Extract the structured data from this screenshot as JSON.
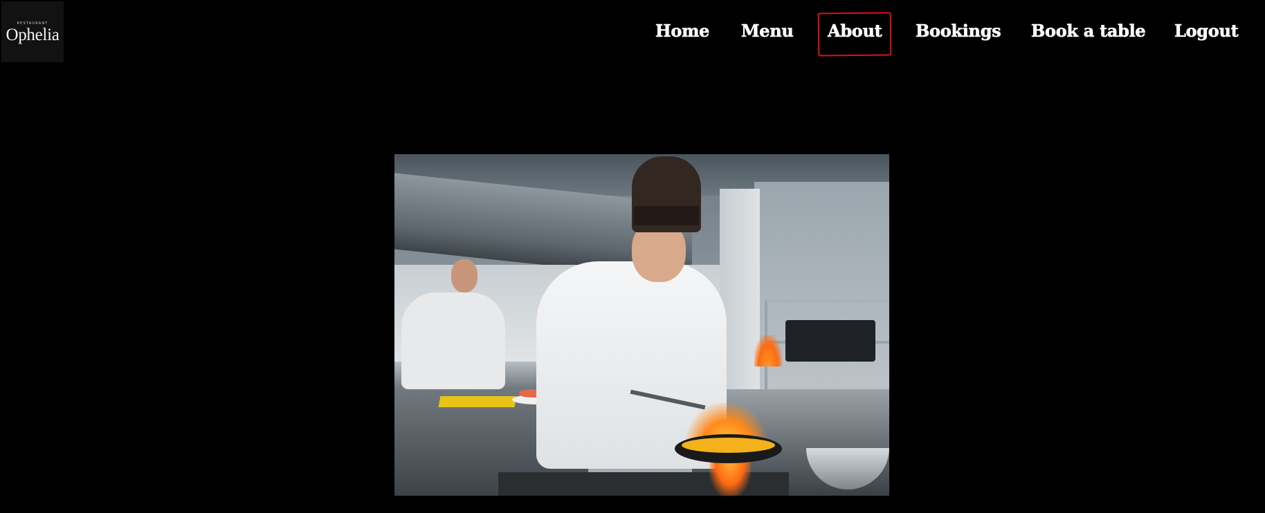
{
  "logo": {
    "small_text": "RESTAURANT",
    "name": "Ophelia"
  },
  "nav": {
    "items": [
      {
        "label": "Home"
      },
      {
        "label": "Menu"
      },
      {
        "label": "About"
      },
      {
        "label": "Bookings"
      },
      {
        "label": "Book a table"
      },
      {
        "label": "Logout"
      }
    ],
    "highlighted": "About"
  },
  "hero": {
    "image": "chef-cooking-flambe"
  },
  "colors": {
    "background": "#000000",
    "nav_text": "#ffffff",
    "highlight": "#e0101a"
  }
}
